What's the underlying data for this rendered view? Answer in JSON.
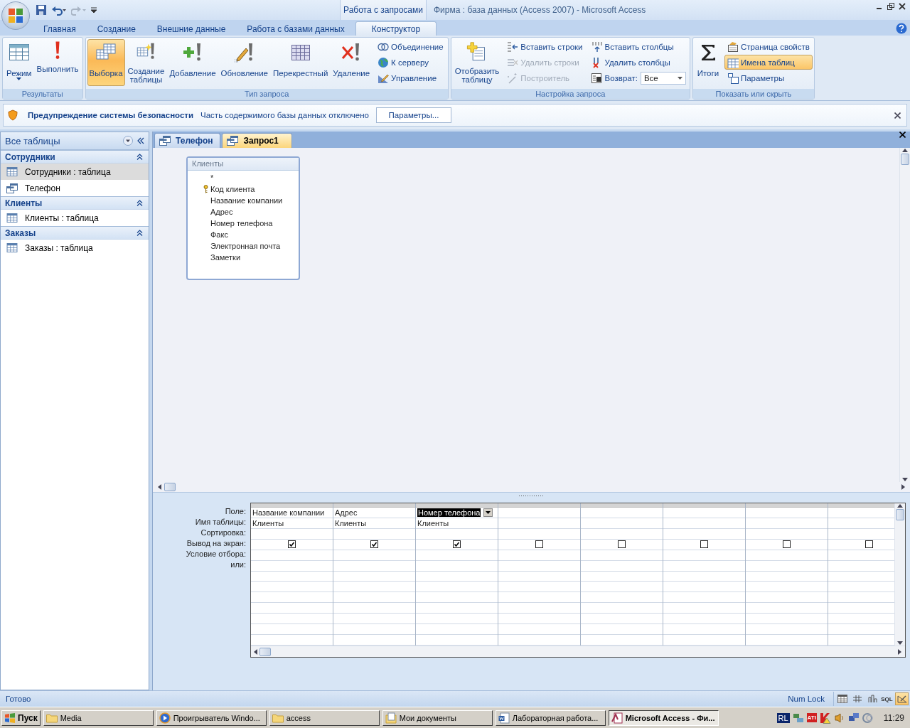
{
  "window": {
    "title": "Фирма : база данных (Access 2007) - Microsoft Access",
    "context_tab": "Работа с запросами"
  },
  "ribbon_tabs": [
    {
      "label": "Главная",
      "selected": false
    },
    {
      "label": "Создание",
      "selected": false
    },
    {
      "label": "Внешние данные",
      "selected": false
    },
    {
      "label": "Работа с базами данных",
      "selected": false
    },
    {
      "label": "Конструктор",
      "selected": true
    }
  ],
  "ribbon_groups": [
    {
      "title": "Результаты",
      "items": [
        {
          "kind": "large",
          "label": "Режим",
          "has_menu": true,
          "selected": false,
          "disabled": false
        },
        {
          "kind": "large",
          "label": "Выполнить",
          "selected": false,
          "disabled": false
        }
      ]
    },
    {
      "title": "Тип запроса",
      "items": [
        {
          "kind": "large",
          "label": "Выборка",
          "selected": true,
          "disabled": false
        },
        {
          "kind": "large",
          "label": "Создание таблицы",
          "selected": false,
          "disabled": false
        },
        {
          "kind": "large",
          "label": "Добавление",
          "selected": false,
          "disabled": false
        },
        {
          "kind": "large",
          "label": "Обновление",
          "selected": false,
          "disabled": false
        },
        {
          "kind": "large",
          "label": "Перекрестный",
          "selected": false,
          "disabled": false
        },
        {
          "kind": "large",
          "label": "Удаление",
          "selected": false,
          "disabled": false
        },
        {
          "kind": "small",
          "label": "Объединение",
          "selected": false,
          "disabled": false
        },
        {
          "kind": "small",
          "label": "К серверу",
          "selected": false,
          "disabled": false
        },
        {
          "kind": "small",
          "label": "Управление",
          "selected": false,
          "disabled": false
        }
      ]
    },
    {
      "title": "Настройка запроса",
      "items": [
        {
          "kind": "large",
          "label": "Отобразить таблицу",
          "selected": false,
          "disabled": false
        },
        {
          "kind": "small",
          "label": "Вставить строки",
          "selected": false,
          "disabled": false
        },
        {
          "kind": "small",
          "label": "Удалить строки",
          "selected": false,
          "disabled": true
        },
        {
          "kind": "small",
          "label": "Построитель",
          "selected": false,
          "disabled": true
        },
        {
          "kind": "small",
          "label": "Вставить столбцы",
          "selected": false,
          "disabled": false
        },
        {
          "kind": "small",
          "label": "Удалить столбцы",
          "selected": false,
          "disabled": false
        },
        {
          "kind": "combo",
          "label": "Возврат:",
          "value": "Все"
        }
      ]
    },
    {
      "title": "Показать или скрыть",
      "items": [
        {
          "kind": "large",
          "label": "Итоги",
          "selected": false,
          "disabled": false
        },
        {
          "kind": "small",
          "label": "Страница свойств",
          "selected": false,
          "disabled": false
        },
        {
          "kind": "small",
          "label": "Имена таблиц",
          "selected": true,
          "disabled": false
        },
        {
          "kind": "small",
          "label": "Параметры",
          "selected": false,
          "disabled": false
        }
      ]
    }
  ],
  "security_bar": {
    "title": "Предупреждение системы безопасности",
    "message": "Часть содержимого базы данных отключено",
    "button": "Параметры..."
  },
  "navigation": {
    "header": "Все таблицы",
    "groups": [
      {
        "title": "Сотрудники",
        "expanded": true,
        "items": [
          {
            "label": "Сотрудники : таблица",
            "kind": "table",
            "selected": true
          },
          {
            "label": "Телефон",
            "kind": "query",
            "selected": false
          }
        ]
      },
      {
        "title": "Клиенты",
        "expanded": true,
        "items": [
          {
            "label": "Клиенты : таблица",
            "kind": "table",
            "selected": false
          }
        ]
      },
      {
        "title": "Заказы",
        "expanded": true,
        "items": [
          {
            "label": "Заказы : таблица",
            "kind": "table",
            "selected": false
          }
        ]
      }
    ]
  },
  "document_tabs": [
    {
      "label": "Телефон",
      "selected": false
    },
    {
      "label": "Запрос1",
      "selected": true
    }
  ],
  "query_tables": [
    {
      "title": "Клиенты",
      "fields": [
        {
          "name": "*",
          "key": false
        },
        {
          "name": "Код клиента",
          "key": true
        },
        {
          "name": "Название компании",
          "key": false
        },
        {
          "name": "Адрес",
          "key": false
        },
        {
          "name": "Номер телефона",
          "key": false
        },
        {
          "name": "Факс",
          "key": false
        },
        {
          "name": "Электронная почта",
          "key": false
        },
        {
          "name": "Заметки",
          "key": false
        }
      ]
    }
  ],
  "design_grid": {
    "row_labels": [
      "Поле:",
      "Имя таблицы:",
      "Сортировка:",
      "Вывод на экран:",
      "Условие отбора:",
      "или:"
    ],
    "columns": [
      {
        "field": "Название компании",
        "table": "Клиенты",
        "show": true,
        "selected": false
      },
      {
        "field": "Адрес",
        "table": "Клиенты",
        "show": true,
        "selected": false
      },
      {
        "field": "Номер телефона",
        "table": "Клиенты",
        "show": true,
        "selected": true
      },
      {
        "show": false,
        "selected": false
      },
      {
        "show": false,
        "selected": false
      },
      {
        "show": false,
        "selected": false
      },
      {
        "show": false,
        "selected": false
      },
      {
        "show": false,
        "selected": false
      }
    ]
  },
  "status_bar": {
    "text": "Готово",
    "indicator": "Num Lock",
    "views": [
      {
        "kind": "datasheet",
        "selected": false
      },
      {
        "kind": "pivot_table",
        "selected": false
      },
      {
        "kind": "pivot_chart",
        "selected": false
      },
      {
        "kind": "sql",
        "label": "SQL",
        "selected": false
      },
      {
        "kind": "design",
        "selected": true
      }
    ]
  },
  "taskbar": {
    "start": "Пуск",
    "buttons": [
      {
        "label": "Media",
        "kind": "folder",
        "selected": false
      },
      {
        "label": "Проигрыватель Windo...",
        "kind": "player",
        "selected": false
      },
      {
        "label": "access",
        "kind": "folder",
        "selected": false
      },
      {
        "label": "Мои документы",
        "kind": "documents",
        "selected": false
      },
      {
        "label": "Лабораторная работа...",
        "kind": "word",
        "selected": false
      },
      {
        "label": "Microsoft Access - Фи...",
        "kind": "access",
        "selected": true
      }
    ],
    "language": "RL",
    "tray_icons": [
      {
        "kind": "network"
      },
      {
        "kind": "ati",
        "label": "ATI"
      },
      {
        "kind": "antivirus"
      },
      {
        "kind": "volume"
      },
      {
        "kind": "monitors"
      },
      {
        "kind": "sync"
      }
    ],
    "clock": "11:29"
  }
}
